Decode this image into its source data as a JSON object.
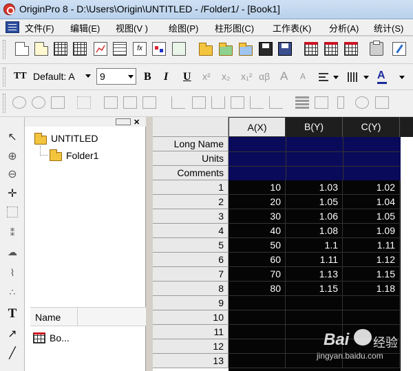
{
  "window": {
    "title": "OriginPro 8 - D:\\Users\\Origin\\UNTITLED - /Folder1/ - [Book1]"
  },
  "menu": [
    "文件(F)",
    "编辑(E)",
    "视图(V )",
    "绘图(P)",
    "柱形图(C)",
    "工作表(K)",
    "分析(A)",
    "统计(S)"
  ],
  "format_bar": {
    "font_style_icon": "TT",
    "font_name": "Default: A",
    "font_size": "9",
    "bold": "B",
    "italic": "I",
    "underline": "U",
    "superscript": "x²",
    "subscript": "x₂",
    "supsub": "x₁²",
    "greek": "αβ",
    "grow_font": "A",
    "shrink_font": "A"
  },
  "explorer": {
    "root": "UNTITLED",
    "folder": "Folder1",
    "name_header": "Name",
    "item": "Bo..."
  },
  "worksheet": {
    "columns": [
      "A(X)",
      "B(Y)",
      "C(Y)"
    ],
    "meta_rows": [
      "Long Name",
      "Units",
      "Comments"
    ],
    "rows": [
      {
        "n": "1",
        "a": "10",
        "b": "1.03",
        "c": "1.02"
      },
      {
        "n": "2",
        "a": "20",
        "b": "1.05",
        "c": "1.04"
      },
      {
        "n": "3",
        "a": "30",
        "b": "1.06",
        "c": "1.05"
      },
      {
        "n": "4",
        "a": "40",
        "b": "1.08",
        "c": "1.09"
      },
      {
        "n": "5",
        "a": "50",
        "b": "1.1",
        "c": "1.11"
      },
      {
        "n": "6",
        "a": "60",
        "b": "1.11",
        "c": "1.12"
      },
      {
        "n": "7",
        "a": "70",
        "b": "1.13",
        "c": "1.15"
      },
      {
        "n": "8",
        "a": "80",
        "b": "1.15",
        "c": "1.18"
      },
      {
        "n": "9",
        "a": "",
        "b": "",
        "c": ""
      },
      {
        "n": "10",
        "a": "",
        "b": "",
        "c": ""
      },
      {
        "n": "11",
        "a": "",
        "b": "",
        "c": ""
      },
      {
        "n": "12",
        "a": "",
        "b": "",
        "c": ""
      },
      {
        "n": "13",
        "a": "",
        "b": "",
        "c": ""
      }
    ]
  },
  "watermark": {
    "brand": "Bai",
    "brand2": "经验",
    "url": "jingyan.baidu.com"
  },
  "colors": {
    "selection": "#0a0a5a",
    "sheet_bg": "#050505",
    "header_bg": "#1e1e1e"
  }
}
